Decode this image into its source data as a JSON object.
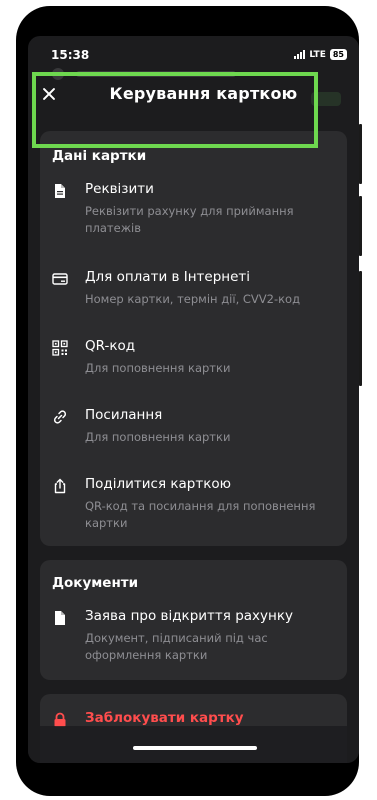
{
  "status": {
    "time": "15:38",
    "network": "LTE",
    "battery": "85"
  },
  "header": {
    "title": "Керування карткою"
  },
  "card_details": {
    "title": "Дані картки",
    "items": [
      {
        "icon": "document-icon",
        "label": "Реквізити",
        "sub": "Реквізити рахунку для приймання платежів"
      },
      {
        "icon": "card-icon",
        "label": "Для оплати в Інтернеті",
        "sub": "Номер картки, термін дії, CVV2-код"
      },
      {
        "icon": "qr-code-icon",
        "label": "QR-код",
        "sub": "Для поповнення картки"
      },
      {
        "icon": "link-icon",
        "label": "Посилання",
        "sub": "Для поповнення картки"
      },
      {
        "icon": "share-icon",
        "label": "Поділитися карткою",
        "sub": "QR-код та посилання для поповнення картки"
      }
    ]
  },
  "documents": {
    "title": "Документи",
    "items": [
      {
        "icon": "document-icon",
        "label": "Заява про відкриття рахунку",
        "sub": "Документ, підписаний під час оформлення картки"
      }
    ]
  },
  "block": {
    "icon": "lock-icon",
    "label": "Заблокувати картку"
  },
  "colors": {
    "highlight": "#6ed84f",
    "danger": "#ff4d4d",
    "background": "#1c1c1e",
    "card": "#2c2c2e"
  }
}
